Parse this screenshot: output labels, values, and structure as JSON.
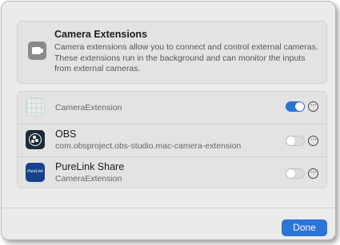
{
  "info": {
    "title": "Camera Extensions",
    "description": "Camera extensions allow you to connect and control external cameras. These extensions run in the background and can monitor the inputs from external cameras.",
    "icon": "camera-extension-icon"
  },
  "extensions": [
    {
      "name": "",
      "subtitle": "CameraExtension",
      "icon": "generic-app-icon",
      "enabled": true
    },
    {
      "name": "OBS",
      "subtitle": "com.obsproject.obs-studio.mac-camera-extension",
      "icon": "obs-icon",
      "enabled": false
    },
    {
      "name": "PureLink Share",
      "subtitle": "CameraExtension",
      "icon": "purelink-icon",
      "icon_text": "PureLink",
      "enabled": false
    }
  ],
  "more_glyph": "···",
  "footer": {
    "done_label": "Done"
  },
  "colors": {
    "accent": "#2b74d8",
    "background": "#ebebeb",
    "group_bg": "#e3e3e3"
  }
}
